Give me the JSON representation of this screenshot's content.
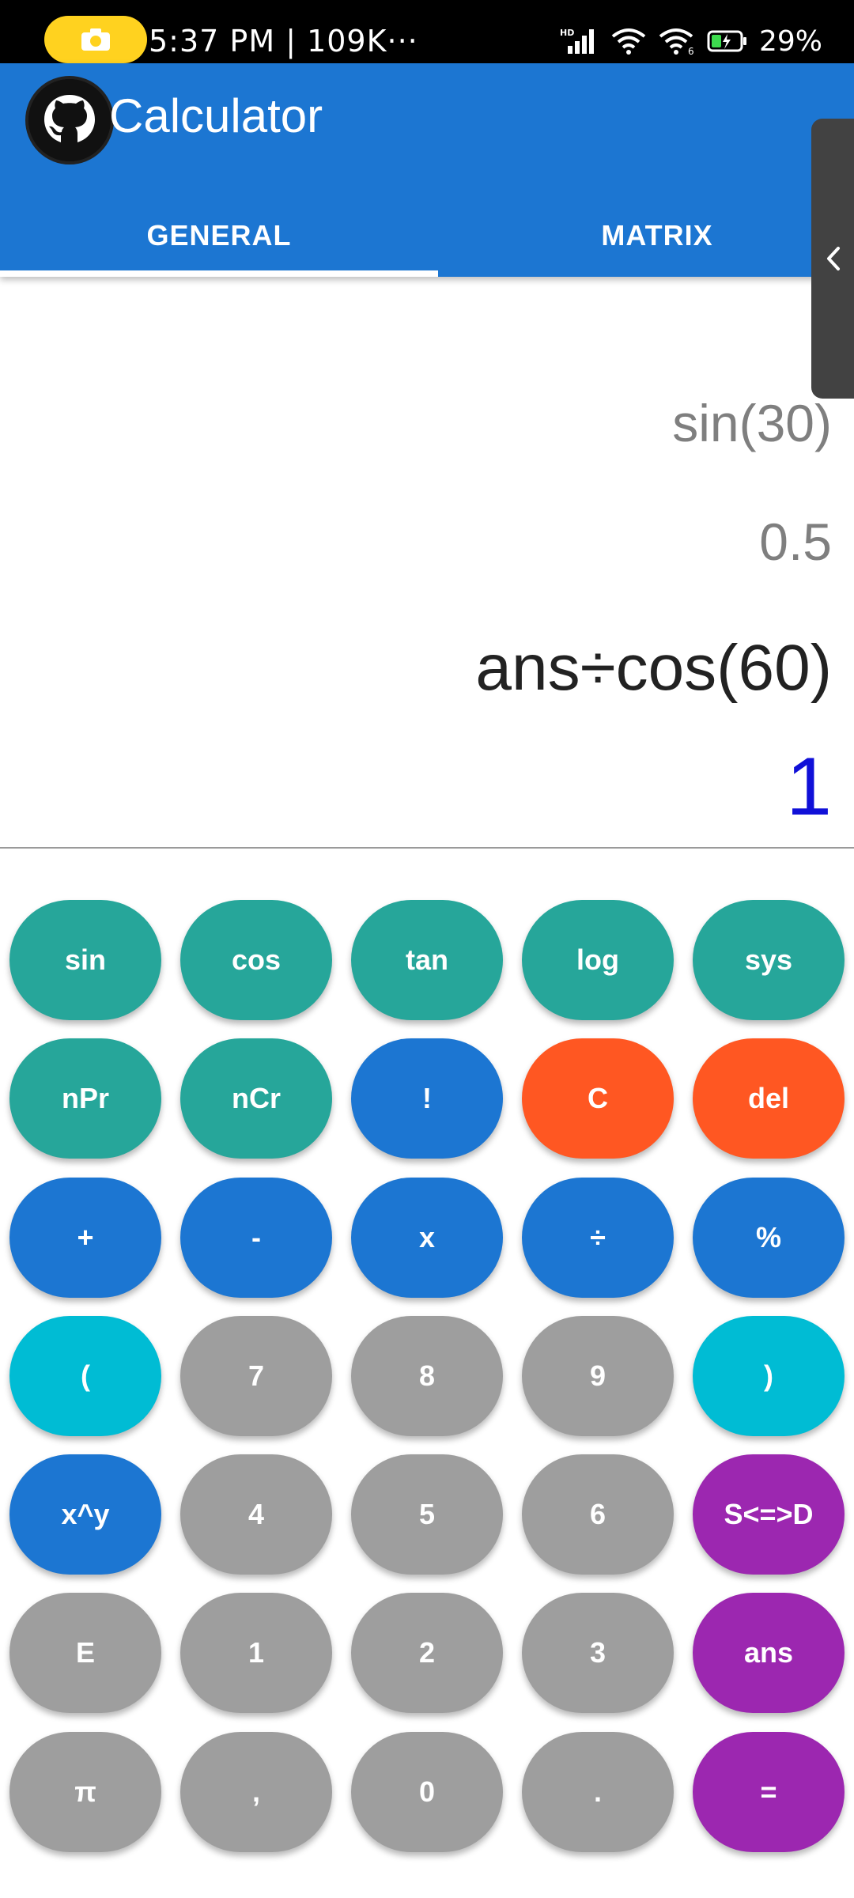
{
  "status_bar": {
    "time": "5:37 PM | 109K···",
    "battery": "29%",
    "icons": [
      "camera-icon",
      "signal-icon",
      "wifi-icon",
      "wifi-6-icon",
      "battery-icon"
    ]
  },
  "app_bar": {
    "title": "Calculator",
    "logo_icon": "github-icon",
    "color": "#1c76d2"
  },
  "tabs": [
    {
      "label": "GENERAL",
      "selected": true
    },
    {
      "label": "MATRIX",
      "selected": false
    }
  ],
  "display": {
    "history_expression": "sin(30)",
    "history_result": "0.5",
    "current_expression": "ans÷cos(60)",
    "current_result": "1"
  },
  "keypad": {
    "rows": [
      [
        "sin",
        "cos",
        "tan",
        "log",
        "sys"
      ],
      [
        "nPr",
        "nCr",
        "!",
        "C",
        "del"
      ],
      [
        "+",
        "-",
        "x",
        "÷",
        "%"
      ],
      [
        "(",
        "7",
        "8",
        "9",
        ")"
      ],
      [
        "x^y",
        "4",
        "5",
        "6",
        "S<=>D"
      ],
      [
        "E",
        "1",
        "2",
        "3",
        "ans"
      ],
      [
        "π",
        ",",
        "0",
        ".",
        "="
      ]
    ],
    "colors": {
      "teal": "#26a69a",
      "blue": "#1c76d2",
      "orange": "#ff5722",
      "cyan": "#00bcd4",
      "grey": "#9e9e9e",
      "purple": "#9c27b0"
    }
  }
}
